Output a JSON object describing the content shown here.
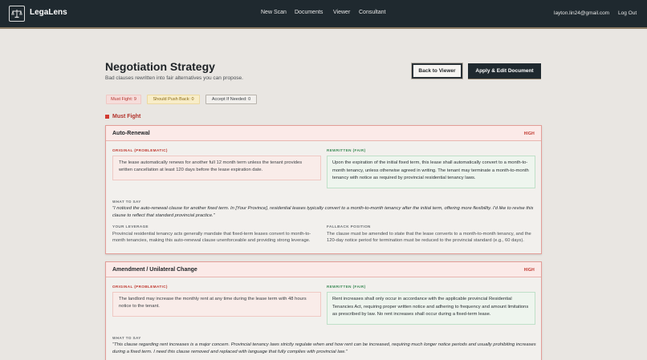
{
  "app": {
    "brand": "LegaLens",
    "nav": [
      "New Scan",
      "Documents",
      "Viewer",
      "Consultant"
    ],
    "email": "layton.lin24@gmail.com",
    "logout": "Log Out"
  },
  "page": {
    "title": "Negotiation Strategy",
    "subtitle": "Bad clauses rewritten into fair alternatives you can propose.",
    "back_button": "Back to Viewer",
    "apply_button": "Apply & Edit Document"
  },
  "counts": {
    "must_fight": "Must Fight: 9",
    "push_back": "Should Push Back: 0",
    "accept": "Accept If Needed: 0"
  },
  "section": {
    "must_fight_label": "Must Fight"
  },
  "labels": {
    "original": "ORIGINAL (PROBLEMATIC)",
    "rewritten": "REWRITTEN (FAIR)",
    "what_to_say": "WHAT TO SAY",
    "leverage": "YOUR LEVERAGE",
    "fallback": "FALLBACK POSITION"
  },
  "clauses": [
    {
      "title": "Auto-Renewal",
      "severity": "HIGH",
      "original": "The lease automatically renews for another full 12 month term unless the tenant provides written cancellation at least 120 days before the lease expiration date.",
      "rewritten": "Upon the expiration of the initial fixed term, this lease shall automatically convert to a month-to-month tenancy, unless otherwise agreed in writing. The tenant may terminate a month-to-month tenancy with notice as required by provincial residential tenancy laws.",
      "what_to_say": "\"I noticed the auto-renewal clause for another fixed term. In [Your Province], residential leases typically convert to a month-to-month tenancy after the initial term, offering more flexibility. I'd like to revise this clause to reflect that standard provincial practice.\"",
      "leverage": "Provincial residential tenancy acts generally mandate that fixed-term leases convert to month-to-month tenancies, making this auto-renewal clause unenforceable and providing strong leverage.",
      "fallback": "The clause must be amended to state that the lease converts to a month-to-month tenancy, and the 120-day notice period for termination must be reduced to the provincial standard (e.g., 60 days)."
    },
    {
      "title": "Amendment / Unilateral Change",
      "severity": "HIGH",
      "original": "The landlord may increase the monthly rent at any time during the lease term with 48 hours notice to the tenant.",
      "rewritten": "Rent increases shall only occur in accordance with the applicable provincial Residential Tenancies Act, requiring proper written notice and adhering to frequency and amount limitations as prescribed by law. No rent increases shall occur during a fixed-term lease.",
      "what_to_say": "\"This clause regarding rent increases is a major concern. Provincial tenancy laws strictly regulate when and how rent can be increased, requiring much longer notice periods and usually prohibiting increases during a fixed term. I need this clause removed and replaced with language that fully complies with provincial law.\""
    }
  ]
}
